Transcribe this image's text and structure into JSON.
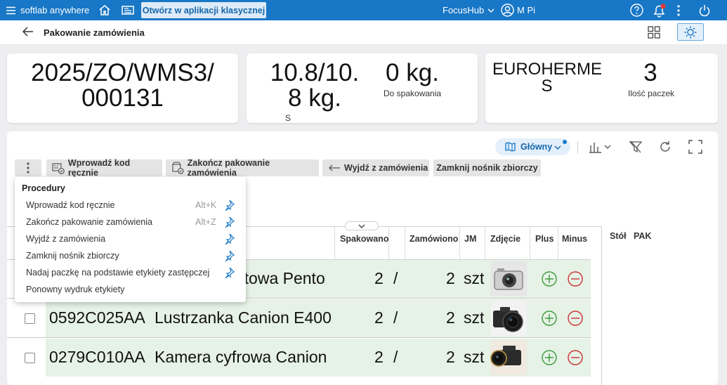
{
  "topbar": {
    "brand": "softlab anywhere",
    "classic_button": "Otwórz w aplikacji klasycznej",
    "workspace": "FocusHub",
    "user": "M Pi"
  },
  "header": {
    "title": "Pakowanie zamówienia"
  },
  "summary": {
    "order_line1": "2025/ZO/WMS3/",
    "order_line2": "000131",
    "weight_line1": "10.8/10.",
    "weight_line2": "8 kg.",
    "weight_caption_partial": "S",
    "to_pack_value": "0 kg.",
    "to_pack_label": "Do spakowania",
    "carrier_line1": "EUROHERME",
    "carrier_line2": "S",
    "packages_value": "3",
    "packages_label": "Ilość paczek"
  },
  "panel": {
    "view_label": "Główny"
  },
  "toolbar": {
    "manual_code": "Wprowadź kod ręcznie",
    "finish_packing": "Zakończ pakowanie zamówienia",
    "exit_order": "Wyjdź z zamówienia",
    "close_carrier": "Zamknij nośnik zbiorczy"
  },
  "menu": {
    "title": "Procedury",
    "items": [
      {
        "label": "Wprowadź kod ręcznie",
        "shortcut": "Alt+K"
      },
      {
        "label": "Zakończ pakowanie zamówienia",
        "shortcut": "Alt+Z"
      },
      {
        "label": "Wyjdź z zamówienia",
        "shortcut": ""
      },
      {
        "label": "Zamknij nośnik zbiorczy",
        "shortcut": ""
      },
      {
        "label": "Nadaj paczkę na podstawie etykiety zastępczej",
        "shortcut": ""
      },
      {
        "label": "Ponowny wydruk etykiety",
        "shortcut": ""
      }
    ]
  },
  "table": {
    "headers": {
      "packed": "Spakowano",
      "ordered": "Zamówiono",
      "unit": "JM",
      "photo": "Zdjęcie",
      "plus": "Plus",
      "minus": "Minus"
    },
    "rows": [
      {
        "code": "",
        "name": "rtowa Pento",
        "packed": "2",
        "sep": "/",
        "ordered": "2",
        "unit": "szt"
      },
      {
        "code": "0592C025AA",
        "name": "Lustrzanka Canion E400",
        "packed": "2",
        "sep": "/",
        "ordered": "2",
        "unit": "szt"
      },
      {
        "code": "0279C010AA",
        "name": "Kamera cyfrowa Canion",
        "packed": "2",
        "sep": "/",
        "ordered": "2",
        "unit": "szt"
      }
    ]
  },
  "side_table": {
    "col1": "Stół",
    "col2": "PAK"
  },
  "colors": {
    "topbar": "#1877c6",
    "row_highlight": "#e6f2e6",
    "plus": "#3a9a3a",
    "minus": "#c83232"
  }
}
